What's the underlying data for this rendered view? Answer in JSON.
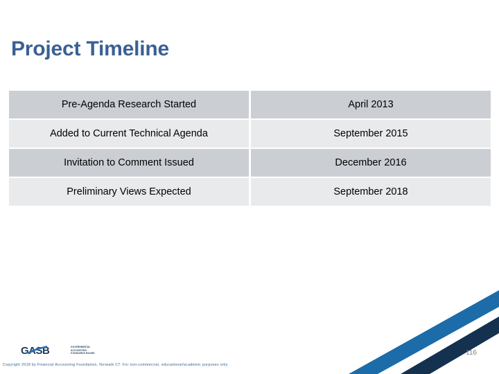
{
  "slide": {
    "title": "Project Timeline",
    "title_color": "#3a6094",
    "background": "#ffffff",
    "page_number": "116"
  },
  "table": {
    "row_color_dark": "#cbced3",
    "row_color_light": "#e8eaec",
    "rows": [
      {
        "event": "Pre-Agenda Research Started",
        "date": "April 2013"
      },
      {
        "event": "Added to Current Technical Agenda",
        "date": "September 2015"
      },
      {
        "event": "Invitation to Comment Issued",
        "date": "December 2016"
      },
      {
        "event": "Preliminary Views Expected",
        "date": "September 2018"
      }
    ]
  },
  "footer": {
    "logo_text": "GASB",
    "logo_tagline_line1": "GOVERNMENTAL",
    "logo_tagline_line2": "ACCOUNTING",
    "logo_tagline_line3": "STANDARDS BOARD",
    "copyright": "Copyright 2018 by Financial Accounting Foundation, Norwalk CT.  For non-commercial, educational/academic purposes only"
  },
  "decoration": {
    "stripe_bright_blue": "#1b6ca8",
    "stripe_navy": "#143150"
  }
}
